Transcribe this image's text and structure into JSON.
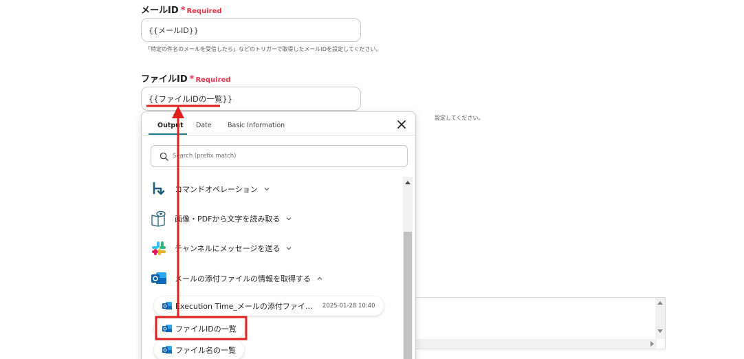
{
  "mail_id_field": {
    "label": "メールID",
    "required_star": "*",
    "required_text": "Required",
    "value": "{{メールID}}",
    "hint": "「特定の件名のメールを受信したら」などのトリガーで取得したメールIDを設定してください。"
  },
  "file_id_field": {
    "label": "ファイルID",
    "required_star": "*",
    "required_text": "Required",
    "value": "{{ファイルIDの一覧}}",
    "hint_tail": "設定してください。"
  },
  "popup": {
    "tabs": [
      {
        "label": "Output"
      },
      {
        "label": "Date"
      },
      {
        "label": "Basic Information"
      }
    ],
    "search": {
      "placeholder": "Search (prefix match)"
    },
    "groups": [
      {
        "label": "コマンドオペレーション",
        "icon": "command-operation-icon"
      },
      {
        "label": "画像・PDFから文字を読み取る",
        "icon": "ocr-book-icon"
      },
      {
        "label": "チャンネルにメッセージを送る",
        "icon": "slack-icon"
      },
      {
        "label": "メールの添付ファイルの情報を取得する",
        "icon": "outlook-icon"
      }
    ],
    "items": [
      {
        "label": "Execution Time_メールの添付ファイ…",
        "timestamp": "2025-01-28 10:40"
      },
      {
        "label": "ファイルIDの一覧"
      },
      {
        "label": "ファイル名の一覧"
      }
    ]
  },
  "colors": {
    "required": "#e8334a",
    "accent": "#1f7a8c",
    "highlight": "#e0201e",
    "outlook": "#0f6cbd"
  }
}
